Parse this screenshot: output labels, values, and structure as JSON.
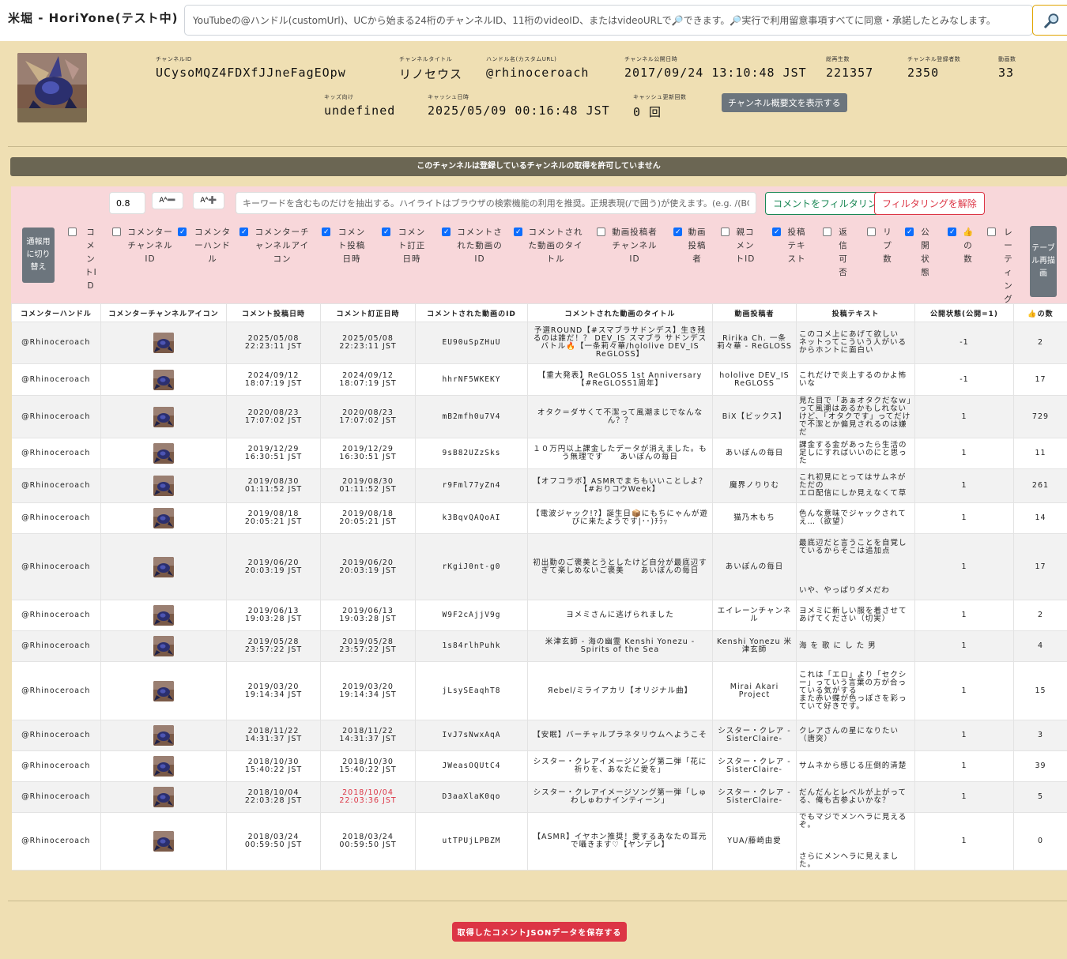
{
  "app": {
    "title": "米堀 - HoriYone(テスト中)",
    "search_placeholder": "YouTubeの@ハンドル(customUrl)、UCから始まる24桁のチャンネルID、11桁のvideoID、またはvideoURLで🔎できます。🔎実行で利用留意事項すべてに同意・承諾したとみなします。",
    "search_icon": "magnifier-icon"
  },
  "channel": {
    "fields": [
      {
        "label": "チャンネルID",
        "value": "UCysoMQZ4FDXfJJneFagEOpw"
      },
      {
        "label": "チャンネルタイトル",
        "value": "リノセウス"
      },
      {
        "label": "ハンドル名(カスタムURL)",
        "value": "@rhinoceroach"
      },
      {
        "label": "チャンネル公開日時",
        "value": "2017/09/24 13:10:48 JST"
      },
      {
        "label": "総再生数",
        "value": "221357"
      },
      {
        "label": "チャンネル登録者数",
        "value": "2350"
      },
      {
        "label": "動画数",
        "value": "33"
      },
      {
        "label": "キッズ向け",
        "value": "undefined"
      },
      {
        "label": "キャッシュ日時",
        "value": "2025/05/09 00:16:48 JST"
      },
      {
        "label": "キャッシュ更新回数",
        "value": "0 回"
      }
    ],
    "desc_button": "チャンネル概要文を表示する"
  },
  "notice": "このチャンネルは登録しているチャンネルの取得を許可していません",
  "filter": {
    "font_size": "0.8",
    "font_down": "Aᴬ➖",
    "font_up": "Aᴬ➕",
    "keyword_placeholder": "キーワードを含むものだけを抽出する。ハイライトはブラウザの検索機能の利用を推奨。正規表現(/で囲う)が使えます。(e.g. /(BC|AD)/)",
    "apply_label": "コメントをフィルタリング",
    "clear_label": "フィルタリングを解除",
    "mode_label": "通報用に切り替え",
    "redraw_label": "テーブル再描画",
    "toggles": [
      {
        "label": "コメントID",
        "checked": false
      },
      {
        "label": "コメンターチャンネルID",
        "checked": false
      },
      {
        "label": "コメンターハンドル",
        "checked": true
      },
      {
        "label": "コメンターチャンネルアイコン",
        "checked": true
      },
      {
        "label": "コメント投稿日時",
        "checked": true
      },
      {
        "label": "コメント訂正日時",
        "checked": true
      },
      {
        "label": "コメントされた動画のID",
        "checked": true
      },
      {
        "label": "コメントされた動画のタイトル",
        "checked": true
      },
      {
        "label": "動画投稿者チャンネルID",
        "checked": false
      },
      {
        "label": "動画投稿者",
        "checked": true
      },
      {
        "label": "親コメントID",
        "checked": false
      },
      {
        "label": "投稿テキスト",
        "checked": true
      },
      {
        "label": "返信可否",
        "checked": false
      },
      {
        "label": "リプ数",
        "checked": false
      },
      {
        "label": "公開状態",
        "checked": true
      },
      {
        "label": "👍の数",
        "checked": true
      },
      {
        "label": "レーティング",
        "checked": false
      }
    ]
  },
  "table": {
    "headers": [
      "コメンターハンドル",
      "コメンターチャンネルアイコン",
      "コメント投稿日時",
      "コメント訂正日時",
      "コメントされた動画のID",
      "コメントされた動画のタイトル",
      "動画投稿者",
      "投稿テキスト",
      "公開状態(公開=1)",
      "👍の数"
    ],
    "rows": [
      {
        "handle": "@Rhinoceroach",
        "posted": "2025/05/08\n22:23:11 JST",
        "edited": "2025/05/08\n22:23:11 JST",
        "edited_changed": false,
        "video_id": "EU90uSpZHuU",
        "title": "予選ROUND【#スマブラサドンデス】生き残るのは誰だ！？ DEV_IS スマブラ サドンデスバトル🔥【一条莉々華/hololive DEV_IS ReGLOSS】",
        "uploader": "Ririka Ch. 一条莉々華 - ReGLOSS",
        "text": "このコメ上にあげて欲しい\nネットってこういう人がいるからホントに面白い",
        "status": "-1",
        "likes": "2"
      },
      {
        "handle": "@Rhinoceroach",
        "posted": "2024/09/12\n18:07:19 JST",
        "edited": "2024/09/12\n18:07:19 JST",
        "edited_changed": false,
        "video_id": "hhrNF5WKEKY",
        "title": "【重大発表】ReGLOSS 1st Anniversary【#ReGLOSS1周年】",
        "uploader": "hololive DEV_IS ReGLOSS",
        "text": "これだけで炎上するのかよ怖いな",
        "status": "-1",
        "likes": "17"
      },
      {
        "handle": "@Rhinoceroach",
        "posted": "2020/08/23\n17:07:02 JST",
        "edited": "2020/08/23\n17:07:02 JST",
        "edited_changed": false,
        "video_id": "mB2mfh0u7V4",
        "title": "オタク＝ダサくて不潔って風潮まじでなんなん？？",
        "uploader": "BiX【ビックス】",
        "text": "見た目で「あぁオタクだなｗ」って風潮はあるかもしれないけど、「オタクです」ってだけで不潔とか偏見されるのは嫌だ",
        "status": "1",
        "likes": "729"
      },
      {
        "handle": "@Rhinoceroach",
        "posted": "2019/12/29\n16:30:51 JST",
        "edited": "2019/12/29\n16:30:51 JST",
        "edited_changed": false,
        "video_id": "9sB82UZzSks",
        "title": "１０万円以上課金したデータが消えました。もう無理です　　あいぽんの毎日",
        "uploader": "あいぽんの毎日",
        "text": "課金する金があったら生活の足しにすればいいのにと思った",
        "status": "1",
        "likes": "11"
      },
      {
        "handle": "@Rhinoceroach",
        "posted": "2019/08/30\n01:11:52 JST",
        "edited": "2019/08/30\n01:11:52 JST",
        "edited_changed": false,
        "video_id": "r9Fml77yZn4",
        "title": "【オフコラボ】ASMRでまちもいいことしよ？【#おりコウWeek】",
        "uploader": "魔界ノりりむ",
        "text": "これ初見にとってはサムネがただの\nエロ配信にしか見えなくて草",
        "status": "1",
        "likes": "261"
      },
      {
        "handle": "@Rhinoceroach",
        "posted": "2019/08/18\n20:05:21 JST",
        "edited": "2019/08/18\n20:05:21 JST",
        "edited_changed": false,
        "video_id": "k3BqvQAQoAI",
        "title": "【電波ジャック!?】誕生日📦にもちにゃんが遊びに来たようです|･･)ﾁﾗｯ",
        "uploader": "猫乃木もち",
        "text": "色んな意味でジャックされてえ…（欲望）",
        "status": "1",
        "likes": "14"
      },
      {
        "handle": "@Rhinoceroach",
        "posted": "2019/06/20\n20:03:19 JST",
        "edited": "2019/06/20\n20:03:19 JST",
        "edited_changed": false,
        "video_id": "rKgiJ0nt-g0",
        "title": "初出勤のご褒美とうとしたけど自分が最底辺すぎて楽しめないご褒美　　あいぽんの毎日",
        "uploader": "あいぽんの毎日",
        "text": "最底辺だと言うことを自覚しているからそこは追加点\n\n\n\n\nいや、やっぱりダメだわ",
        "status": "1",
        "likes": "17"
      },
      {
        "handle": "@Rhinoceroach",
        "posted": "2019/06/13\n19:03:28 JST",
        "edited": "2019/06/13\n19:03:28 JST",
        "edited_changed": false,
        "video_id": "W9F2cAjjV9g",
        "title": "ヨメミさんに逃げられました",
        "uploader": "エイレーンチャンネル",
        "text": "ヨメミに新しい服を着させてあげてください（切実）",
        "status": "1",
        "likes": "2"
      },
      {
        "handle": "@Rhinoceroach",
        "posted": "2019/05/28\n23:57:22 JST",
        "edited": "2019/05/28\n23:57:22 JST",
        "edited_changed": false,
        "video_id": "1s84rlhPuhk",
        "title": "米津玄師 - 海の幽霊 Kenshi Yonezu - Spirits of the Sea",
        "uploader": "Kenshi Yonezu 米津玄師",
        "text": "海 を 歌 に し た 男",
        "status": "1",
        "likes": "4"
      },
      {
        "handle": "@Rhinoceroach",
        "posted": "2019/03/20\n19:14:34 JST",
        "edited": "2019/03/20\n19:14:34 JST",
        "edited_changed": false,
        "video_id": "jLsySEaqhT8",
        "title": "Яebel/ミライアカリ【オリジナル曲】",
        "uploader": "Mirai Akari Project",
        "text": "これは「エロ」より「セクシー」っていう言葉の方が合っている気がする\nまた赤い蝶が色っぽさを彩っていて好きです。",
        "status": "1",
        "likes": "15"
      },
      {
        "handle": "@Rhinoceroach",
        "posted": "2018/11/22\n14:31:37 JST",
        "edited": "2018/11/22\n14:31:37 JST",
        "edited_changed": false,
        "video_id": "IvJ7sNwxAqA",
        "title": "【安眠】バーチャルプラネタリウムへようこそ",
        "uploader": "シスター・クレア -SisterClaire-",
        "text": "クレアさんの星になりたい（唐突）",
        "status": "1",
        "likes": "3"
      },
      {
        "handle": "@Rhinoceroach",
        "posted": "2018/10/30\n15:40:22 JST",
        "edited": "2018/10/30\n15:40:22 JST",
        "edited_changed": false,
        "video_id": "JWeasOQUtC4",
        "title": "シスター・クレアイメージソング第二弾「花に祈りを、あなたに愛を」",
        "uploader": "シスター・クレア -SisterClaire-",
        "text": "サムネから感じる圧倒的清楚",
        "status": "1",
        "likes": "39"
      },
      {
        "handle": "@Rhinoceroach",
        "posted": "2018/10/04\n22:03:28 JST",
        "edited": "2018/10/04\n22:03:36 JST",
        "edited_changed": true,
        "video_id": "D3aaXlaK0qo",
        "title": "シスター・クレアイメージソング第一弾「しゅわしゅわナインティーン」",
        "uploader": "シスター・クレア -SisterClaire-",
        "text": "だんだんとレベルが上がってる、俺も古参よいかな？",
        "status": "1",
        "likes": "5"
      },
      {
        "handle": "@Rhinoceroach",
        "posted": "2018/03/24\n00:59:50 JST",
        "edited": "2018/03/24\n00:59:50 JST",
        "edited_changed": false,
        "video_id": "utTPUjLPBZM",
        "title": "【ASMR】イヤホン推奨！愛するあなたの耳元で囁きます♡【ヤンデレ】",
        "uploader": "YUA/藤崎由愛",
        "text": "でもマジでメンヘラに見えるぞ。\n\n\n\nさらにメンヘラに見えました。",
        "status": "1",
        "likes": "0"
      }
    ]
  },
  "save_button": "取得したコメントJSONデータを保存する",
  "colors": {
    "background": "#efdfb3",
    "filter_panel": "#f8d7da",
    "checkbox_on": "#0d6efd",
    "save_red": "#dc3545",
    "apply_green": "#198754",
    "edited_red": "#dc3545"
  }
}
